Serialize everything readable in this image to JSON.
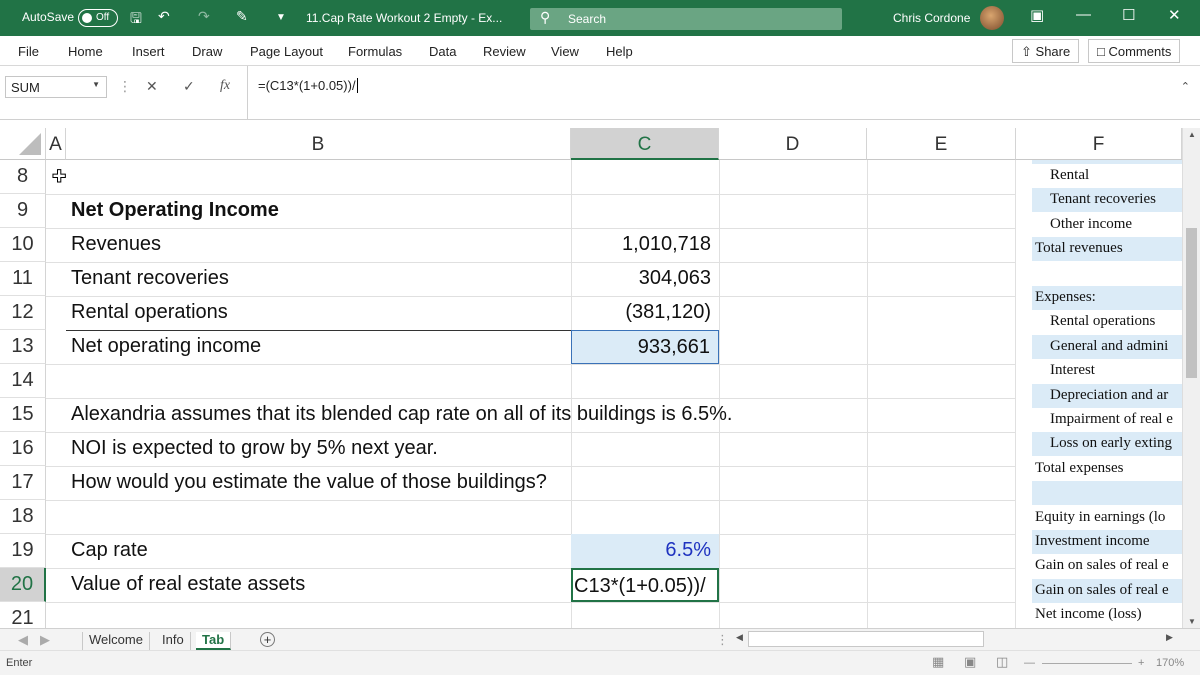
{
  "titlebar": {
    "autosave_label": "AutoSave",
    "autosave_state": "Off",
    "doc_title": "11.Cap Rate Workout 2 Empty  -  Ex...",
    "search_placeholder": "Search",
    "user_name": "Chris Cordone"
  },
  "ribbon": {
    "tabs": [
      "File",
      "Home",
      "Insert",
      "Draw",
      "Page Layout",
      "Formulas",
      "Data",
      "Review",
      "View",
      "Help"
    ],
    "share_label": "Share",
    "comments_label": "Comments"
  },
  "formula_bar": {
    "name_box": "SUM",
    "formula": "=(C13*(1+0.05))/"
  },
  "columns": [
    "A",
    "B",
    "C",
    "D",
    "E",
    "F"
  ],
  "rows": [
    {
      "num": "8",
      "label": "",
      "value": ""
    },
    {
      "num": "9",
      "label": "Net Operating Income",
      "value": ""
    },
    {
      "num": "10",
      "label": "Revenues",
      "value": "1,010,718"
    },
    {
      "num": "11",
      "label": "Tenant recoveries",
      "value": "304,063"
    },
    {
      "num": "12",
      "label": "Rental operations",
      "value": "(381,120)"
    },
    {
      "num": "13",
      "label": "Net operating income",
      "value": "933,661"
    },
    {
      "num": "14",
      "label": "",
      "value": ""
    },
    {
      "num": "15",
      "label": "Alexandria assumes that its blended cap rate on all of its buildings is 6.5%.",
      "value": ""
    },
    {
      "num": "16",
      "label": "NOI is expected to grow by 5% next year.",
      "value": ""
    },
    {
      "num": "17",
      "label": "How would you estimate the value of those buildings?",
      "value": ""
    },
    {
      "num": "18",
      "label": "",
      "value": ""
    },
    {
      "num": "19",
      "label": "Cap rate",
      "value": "6.5%"
    },
    {
      "num": "20",
      "label": "Value of real estate assets",
      "value": "C13*(1+0.05))/"
    },
    {
      "num": "21",
      "label": "",
      "value": ""
    }
  ],
  "column_f": [
    {
      "text": "Rental",
      "indent": true,
      "shade": false
    },
    {
      "text": "Tenant recoveries",
      "indent": true,
      "shade": true
    },
    {
      "text": "Other income",
      "indent": true,
      "shade": false
    },
    {
      "text": "Total revenues",
      "indent": false,
      "shade": true
    },
    {
      "text": "",
      "indent": false,
      "shade": false
    },
    {
      "text": "Expenses:",
      "indent": false,
      "shade": true
    },
    {
      "text": "Rental operations",
      "indent": true,
      "shade": false
    },
    {
      "text": "General and admini",
      "indent": true,
      "shade": true
    },
    {
      "text": "Interest",
      "indent": true,
      "shade": false
    },
    {
      "text": "Depreciation and ar",
      "indent": true,
      "shade": true
    },
    {
      "text": "Impairment of real e",
      "indent": true,
      "shade": false
    },
    {
      "text": "Loss on early exting",
      "indent": true,
      "shade": true
    },
    {
      "text": "Total expenses",
      "indent": false,
      "shade": false
    },
    {
      "text": "",
      "indent": false,
      "shade": true
    },
    {
      "text": "Equity in earnings (lo",
      "indent": false,
      "shade": false
    },
    {
      "text": "Investment income",
      "indent": false,
      "shade": true
    },
    {
      "text": "Gain on sales of real e",
      "indent": false,
      "shade": false
    },
    {
      "text": "Gain on sales of real e",
      "indent": false,
      "shade": true
    },
    {
      "text": "Net income (loss)",
      "indent": false,
      "shade": false
    }
  ],
  "sheets": [
    "Welcome",
    "Info",
    "Tab"
  ],
  "active_sheet": "Tab",
  "status": {
    "mode": "Enter",
    "zoom": "170%"
  },
  "colors": {
    "brand": "#217346",
    "selected_fill": "#dbebf7",
    "cap_rate_text": "#1f33c0"
  }
}
